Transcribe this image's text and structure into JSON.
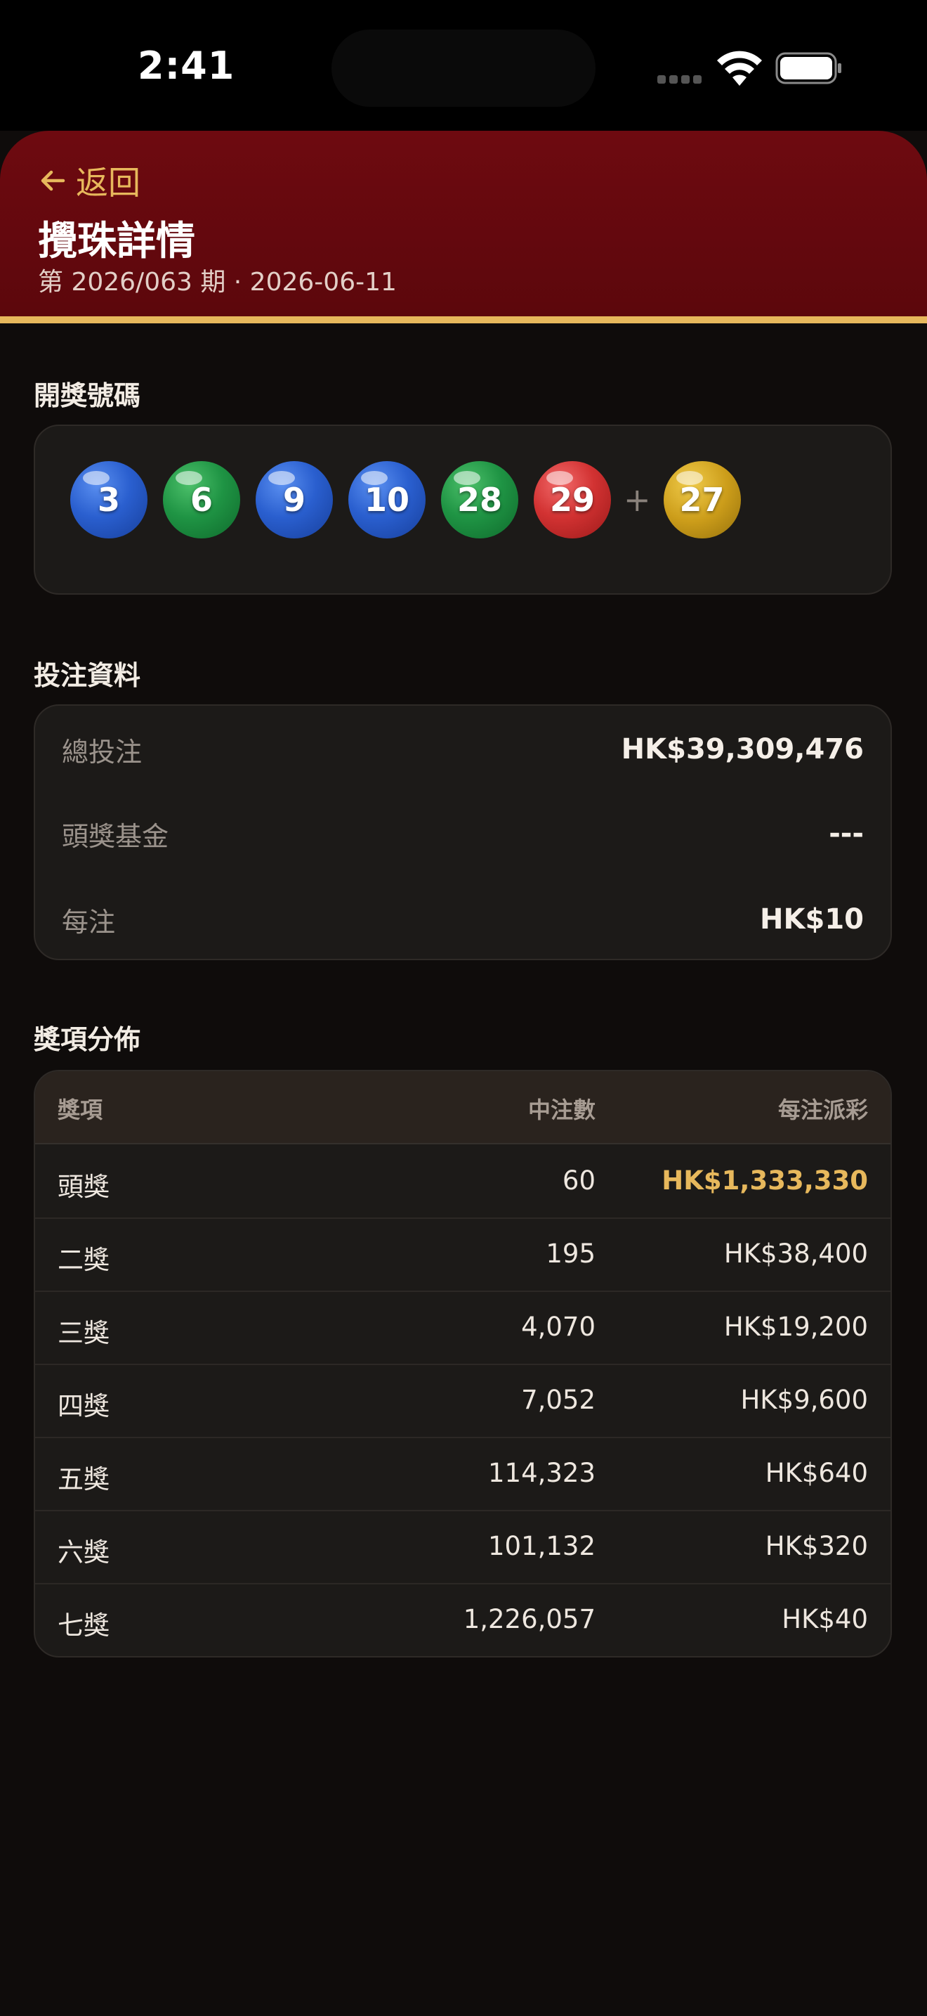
{
  "status_bar": {
    "time": "2:41"
  },
  "header": {
    "back_label": "返回",
    "title": "攪珠詳情",
    "subtitle": "第 2026/063 期 · 2026-06-11"
  },
  "draw_section": {
    "title": "開獎號碼",
    "balls": [
      {
        "number": "3",
        "color": "blue"
      },
      {
        "number": "6",
        "color": "green"
      },
      {
        "number": "9",
        "color": "blue"
      },
      {
        "number": "10",
        "color": "blue"
      },
      {
        "number": "28",
        "color": "green"
      },
      {
        "number": "29",
        "color": "red"
      }
    ],
    "plus": "+",
    "extra_ball": {
      "number": "27",
      "color": "gold"
    }
  },
  "bet_section": {
    "title": "投注資料",
    "rows": [
      {
        "label": "總投注",
        "value": "HK$39,309,476"
      },
      {
        "label": "頭獎基金",
        "value": "---"
      },
      {
        "label": "每注",
        "value": "HK$10"
      }
    ]
  },
  "prize_section": {
    "title": "獎項分佈",
    "headers": [
      "獎項",
      "中注數",
      "每注派彩"
    ],
    "rows": [
      {
        "prize": "頭獎",
        "winners": "60",
        "payout": "HK$1,333,330",
        "highlight": true
      },
      {
        "prize": "二獎",
        "winners": "195",
        "payout": "HK$38,400"
      },
      {
        "prize": "三獎",
        "winners": "4,070",
        "payout": "HK$19,200"
      },
      {
        "prize": "四獎",
        "winners": "7,052",
        "payout": "HK$9,600"
      },
      {
        "prize": "五獎",
        "winners": "114,323",
        "payout": "HK$640"
      },
      {
        "prize": "六獎",
        "winners": "101,132",
        "payout": "HK$320"
      },
      {
        "prize": "七獎",
        "winners": "1,226,057",
        "payout": "HK$40"
      }
    ]
  },
  "colors": {
    "accent_gold": "#e7b85c",
    "header_red": "#6e0a10",
    "background": "#0f0c0b"
  }
}
